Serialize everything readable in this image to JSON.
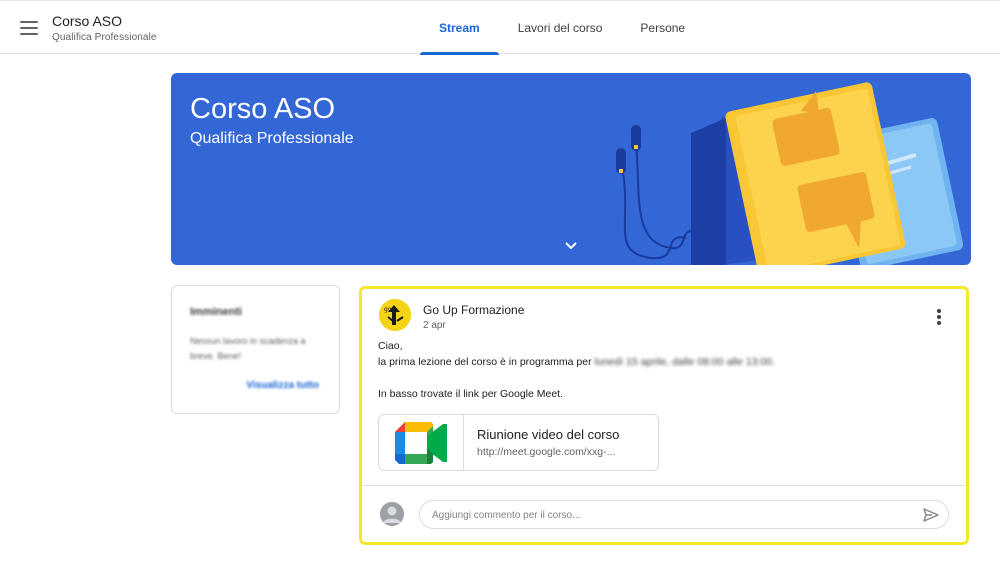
{
  "header": {
    "course_title": "Corso ASO",
    "course_subtitle": "Qualifica Professionale",
    "tabs": [
      {
        "label": "Stream",
        "active": true
      },
      {
        "label": "Lavori del corso",
        "active": false
      },
      {
        "label": "Persone",
        "active": false
      }
    ]
  },
  "banner": {
    "title": "Corso ASO",
    "subtitle": "Qualifica Professionale",
    "background_color": "#3367d6"
  },
  "upcoming": {
    "title": "Imminenti",
    "text": "Nessun lavoro in scadenza a breve. Bene!",
    "link": "Visualizza tutto"
  },
  "post": {
    "author": "Go Up Formazione",
    "date": "2 apr",
    "greeting": "Ciao,",
    "line1": "la prima lezione del corso è in programma per",
    "line1_blurred": "lunedì 15 aprile, dalle 08:00 alle 13:00.",
    "line2": "In basso trovate il link per Google Meet.",
    "attachment": {
      "title": "Riunione video del corso",
      "url": "http://meet.google.com/xxg-..."
    },
    "comment_placeholder": "Aggiungi commento per il corso..."
  },
  "colors": {
    "accent": "#1967d2",
    "highlight_border": "#f5e72a"
  }
}
